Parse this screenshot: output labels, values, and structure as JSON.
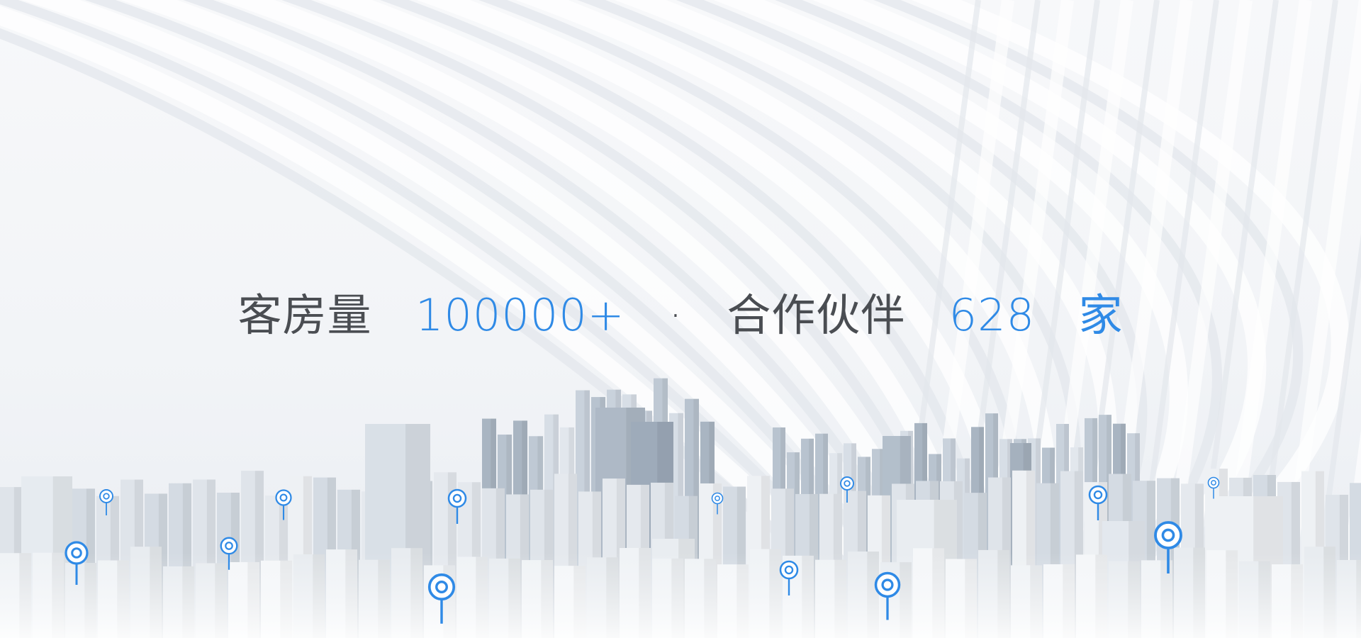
{
  "headline": {
    "part1_label": "客房量",
    "part1_value": "100000+",
    "separator": "·",
    "part2_label": "合作伙伴",
    "part2_value": "628",
    "part2_unit": "家"
  },
  "colors": {
    "accent": "#2f8ae6",
    "text": "#4a4d52",
    "background": "#f4f6f9",
    "building_dark": "#aab6c3",
    "building_light": "#e6ebf0"
  },
  "icons": {
    "location_pin": "location-pin-icon"
  }
}
